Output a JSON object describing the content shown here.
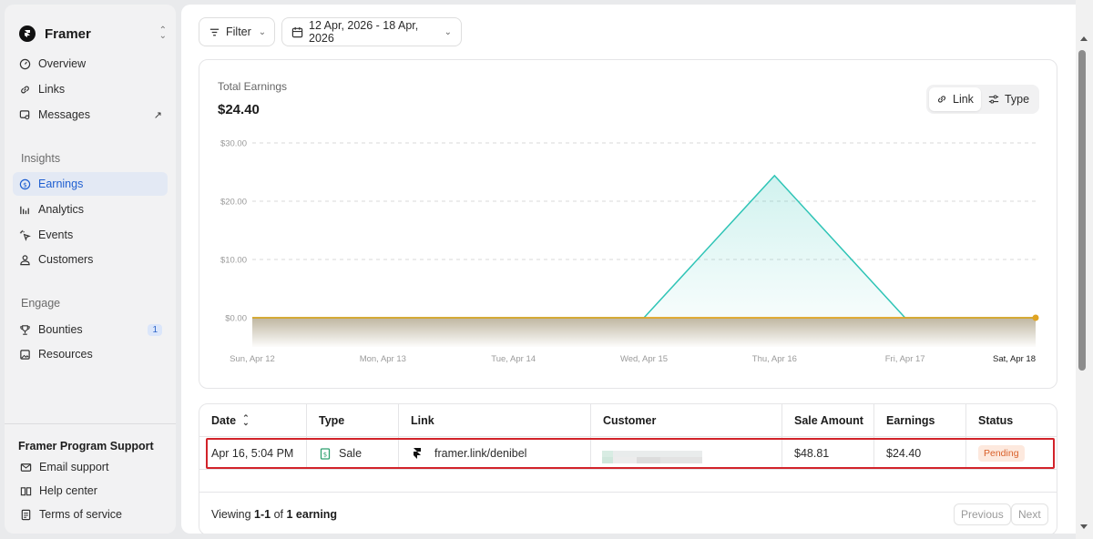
{
  "brand": {
    "name": "Framer"
  },
  "nav": {
    "overview": "Overview",
    "links": "Links",
    "messages": "Messages",
    "insights_label": "Insights",
    "earnings": "Earnings",
    "analytics": "Analytics",
    "events": "Events",
    "customers": "Customers",
    "engage_label": "Engage",
    "bounties": "Bounties",
    "bounties_count": "1",
    "resources": "Resources"
  },
  "support": {
    "title": "Framer Program Support",
    "email": "Email support",
    "help": "Help center",
    "terms": "Terms of service"
  },
  "toolbar": {
    "filter_label": "Filter",
    "date_range": "12 Apr, 2026 - 18 Apr, 2026"
  },
  "earnings_card": {
    "title": "Total Earnings",
    "total": "$24.40",
    "toggle_link": "Link",
    "toggle_type": "Type"
  },
  "chart_data": {
    "type": "area",
    "categories": [
      "Sun, Apr 12",
      "Mon, Apr 13",
      "Tue, Apr 14",
      "Wed, Apr 15",
      "Thu, Apr 16",
      "Fri, Apr 17",
      "Sat, Apr 18"
    ],
    "yticks": [
      "$0.00",
      "$10.00",
      "$20.00",
      "$30.00"
    ],
    "ylim": [
      0,
      30
    ],
    "series": [
      {
        "values": [
          0,
          0,
          0,
          0,
          24.4,
          0,
          0
        ],
        "color": "#2ec4b6"
      },
      {
        "values": [
          0,
          0,
          0,
          0,
          0,
          0,
          0
        ],
        "color": "#e0a422"
      }
    ],
    "grid": true
  },
  "table": {
    "headers": {
      "date": "Date",
      "type": "Type",
      "link": "Link",
      "customer": "Customer",
      "sale_amount": "Sale Amount",
      "earnings": "Earnings",
      "status": "Status"
    },
    "row": {
      "date": "Apr 16, 5:04 PM",
      "type": "Sale",
      "link": "framer.link/denibel",
      "sale_amount": "$48.81",
      "earnings": "$24.40",
      "status": "Pending"
    }
  },
  "pagination": {
    "viewing_prefix": "Viewing ",
    "range": "1-1",
    "of": " of ",
    "count": "1 earning",
    "previous": "Previous",
    "next": "Next"
  },
  "colors": {
    "accent": "#1f5fd1",
    "teal": "#2ec4b6",
    "gold": "#e0a422",
    "pending": "#d9602a",
    "highlight": "#d2232a"
  }
}
